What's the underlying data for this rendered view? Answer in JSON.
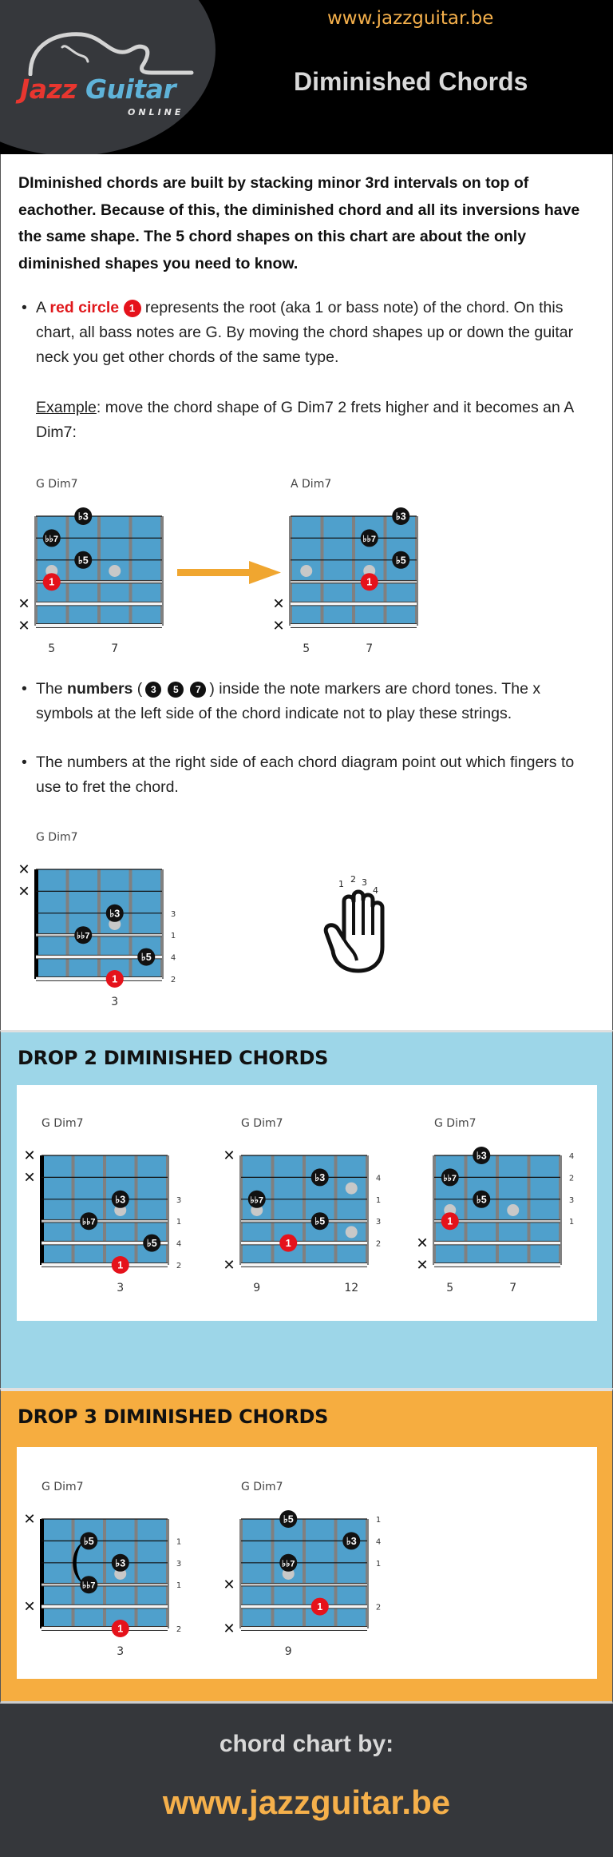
{
  "header": {
    "logo": {
      "word1": "Jazz",
      "word2": "Guitar",
      "sub": "ONLINE"
    },
    "url": "www.jazzguitar.be",
    "title": "Diminished Chords"
  },
  "intro": {
    "lead": "DIminished chords are built by stacking minor 3rd intervals on top of eachother. Because of this, the diminished chord and all its inversions have the same shape. The 5 chord shapes on this chart are about the only diminished shapes you need to know.",
    "bullet1": {
      "prefix": "A ",
      "highlight": "red circle",
      "marker": "1",
      "rest": " represents the root (aka 1 or bass note) of the chord. On this chart, all bass notes are G. By moving the chord shapes up or down the guitar neck you get other chords of the same type."
    },
    "example": {
      "label": "Example",
      "text": ": move the chord shape of G Dim7 2 frets higher and it becomes an A Dim7:"
    },
    "bullet2": {
      "prefix": "The ",
      "bold": "numbers",
      "open": " (",
      "markers": [
        "3",
        "5",
        "7"
      ],
      "rest": ") inside the note markers are chord tones. The x symbols at the left side of the chord indicate not to play these strings."
    },
    "bullet3": "The numbers at the right side of each chord diagram point out which fingers to use to fret the chord.",
    "hand_fingers": [
      "1",
      "2",
      "3",
      "4"
    ]
  },
  "colors": {
    "fretboard": "#4fa0cc",
    "fret": "#808080",
    "root": "#e5121b",
    "note": "#111111",
    "dot": "#c8c8c8",
    "arrow": "#f0a630",
    "drop2_bg": "#9dd6e8",
    "drop3_bg": "#f6ad40",
    "accent": "#f5b04b"
  },
  "chords": {
    "example_g": {
      "title": "G Dim7",
      "muted": [
        5,
        6
      ],
      "fret_labels": [
        {
          "pos": 0.5,
          "text": "5"
        },
        {
          "pos": 2.5,
          "text": "7"
        }
      ],
      "fingers": [],
      "notes": [
        {
          "string": 1,
          "fret": 1.5,
          "label": "b3"
        },
        {
          "string": 2,
          "fret": 0.5,
          "label": "bb7"
        },
        {
          "string": 3,
          "fret": 1.5,
          "label": "b5"
        },
        {
          "string": 4,
          "fret": 0.5,
          "label": "1",
          "root": true
        }
      ],
      "dots": [
        {
          "between": 3.5,
          "fret": 0.5
        },
        {
          "between": 3.5,
          "fret": 2.5
        }
      ],
      "nut": false
    },
    "example_a": {
      "title": "A Dim7",
      "muted": [
        5,
        6
      ],
      "fret_labels": [
        {
          "pos": 0.5,
          "text": "5"
        },
        {
          "pos": 2.5,
          "text": "7"
        }
      ],
      "fingers": [],
      "notes": [
        {
          "string": 1,
          "fret": 3.5,
          "label": "b3"
        },
        {
          "string": 2,
          "fret": 2.5,
          "label": "bb7"
        },
        {
          "string": 3,
          "fret": 3.5,
          "label": "b5"
        },
        {
          "string": 4,
          "fret": 2.5,
          "label": "1",
          "root": true
        }
      ],
      "dots": [
        {
          "between": 3.5,
          "fret": 0.5
        },
        {
          "between": 3.5,
          "fret": 2.5
        }
      ],
      "nut": false
    },
    "finger_example": {
      "title": "G Dim7",
      "muted": [
        1,
        2
      ],
      "fret_labels": [
        {
          "pos": 2.5,
          "text": "3"
        }
      ],
      "fingers": [
        {
          "string": 3,
          "text": "3"
        },
        {
          "string": 4,
          "text": "1"
        },
        {
          "string": 5,
          "text": "4"
        },
        {
          "string": 6,
          "text": "2"
        }
      ],
      "notes": [
        {
          "string": 3,
          "fret": 2.5,
          "label": "b3"
        },
        {
          "string": 4,
          "fret": 1.5,
          "label": "bb7"
        },
        {
          "string": 5,
          "fret": 3.5,
          "label": "b5"
        },
        {
          "string": 6,
          "fret": 2.5,
          "label": "1",
          "root": true
        }
      ],
      "dots": [
        {
          "between": 3.5,
          "fret": 2.5
        }
      ],
      "nut": true
    }
  },
  "drop2": {
    "title": "DROP 2 DIMINISHED CHORDS",
    "chords": [
      {
        "title": "G Dim7",
        "muted": [
          1,
          2
        ],
        "fret_labels": [
          {
            "pos": 2.5,
            "text": "3"
          }
        ],
        "fingers": [
          {
            "string": 3,
            "text": "3"
          },
          {
            "string": 4,
            "text": "1"
          },
          {
            "string": 5,
            "text": "4"
          },
          {
            "string": 6,
            "text": "2"
          }
        ],
        "notes": [
          {
            "string": 3,
            "fret": 2.5,
            "label": "b3"
          },
          {
            "string": 4,
            "fret": 1.5,
            "label": "bb7"
          },
          {
            "string": 5,
            "fret": 3.5,
            "label": "b5"
          },
          {
            "string": 6,
            "fret": 2.5,
            "label": "1",
            "root": true
          }
        ],
        "dots": [
          {
            "between": 3.5,
            "fret": 2.5
          }
        ],
        "nut": true
      },
      {
        "title": "G Dim7",
        "muted": [
          1,
          6
        ],
        "fret_labels": [
          {
            "pos": 0.5,
            "text": "9"
          },
          {
            "pos": 3.5,
            "text": "12"
          }
        ],
        "fingers": [
          {
            "string": 2,
            "text": "4"
          },
          {
            "string": 3,
            "text": "1"
          },
          {
            "string": 4,
            "text": "3"
          },
          {
            "string": 5,
            "text": "2"
          }
        ],
        "notes": [
          {
            "string": 2,
            "fret": 2.5,
            "label": "b3"
          },
          {
            "string": 3,
            "fret": 0.5,
            "label": "bb7"
          },
          {
            "string": 4,
            "fret": 2.5,
            "label": "b5"
          },
          {
            "string": 5,
            "fret": 1.5,
            "label": "1",
            "root": true
          }
        ],
        "dots": [
          {
            "between": 3.5,
            "fret": 0.5
          },
          {
            "between": 2.5,
            "fret": 3.5
          },
          {
            "between": 4.5,
            "fret": 3.5
          }
        ],
        "nut": false
      },
      {
        "title": "G Dim7",
        "muted": [
          5,
          6
        ],
        "fret_labels": [
          {
            "pos": 0.5,
            "text": "5"
          },
          {
            "pos": 2.5,
            "text": "7"
          }
        ],
        "fingers": [
          {
            "string": 1,
            "text": "4"
          },
          {
            "string": 2,
            "text": "2"
          },
          {
            "string": 3,
            "text": "3"
          },
          {
            "string": 4,
            "text": "1"
          }
        ],
        "notes": [
          {
            "string": 1,
            "fret": 1.5,
            "label": "b3"
          },
          {
            "string": 2,
            "fret": 0.5,
            "label": "bb7"
          },
          {
            "string": 3,
            "fret": 1.5,
            "label": "b5"
          },
          {
            "string": 4,
            "fret": 0.5,
            "label": "1",
            "root": true
          }
        ],
        "dots": [
          {
            "between": 3.5,
            "fret": 0.5
          },
          {
            "between": 3.5,
            "fret": 2.5
          }
        ],
        "nut": false
      }
    ]
  },
  "drop3": {
    "title": "DROP 3 DIMINISHED CHORDS",
    "chords": [
      {
        "title": "G Dim7",
        "muted": [
          1,
          5
        ],
        "fret_labels": [
          {
            "pos": 2.5,
            "text": "3"
          }
        ],
        "fingers": [
          {
            "string": 2,
            "text": "1"
          },
          {
            "string": 3,
            "text": "3"
          },
          {
            "string": 4,
            "text": "1"
          },
          {
            "string": 6,
            "text": "2"
          }
        ],
        "notes": [
          {
            "string": 2,
            "fret": 1.5,
            "label": "b5"
          },
          {
            "string": 3,
            "fret": 2.5,
            "label": "b3"
          },
          {
            "string": 4,
            "fret": 1.5,
            "label": "bb7"
          },
          {
            "string": 6,
            "fret": 2.5,
            "label": "1",
            "root": true
          }
        ],
        "dots": [
          {
            "between": 3.5,
            "fret": 2.5
          }
        ],
        "barre": {
          "from": 2,
          "to": 4,
          "fret": 1.5
        },
        "nut": true
      },
      {
        "title": "G Dim7",
        "muted": [
          4,
          6
        ],
        "fret_labels": [
          {
            "pos": 1.5,
            "text": "9"
          }
        ],
        "fingers": [
          {
            "string": 1,
            "text": "1"
          },
          {
            "string": 2,
            "text": "4"
          },
          {
            "string": 3,
            "text": "1"
          },
          {
            "string": 5,
            "text": "2"
          }
        ],
        "notes": [
          {
            "string": 1,
            "fret": 1.5,
            "label": "b5"
          },
          {
            "string": 2,
            "fret": 3.5,
            "label": "b3"
          },
          {
            "string": 3,
            "fret": 1.5,
            "label": "bb7"
          },
          {
            "string": 5,
            "fret": 2.5,
            "label": "1",
            "root": true
          }
        ],
        "dots": [
          {
            "between": 3.5,
            "fret": 1.5
          }
        ],
        "nut": false
      }
    ]
  },
  "footer": {
    "by": "chord chart by:",
    "url": "www.jazzguitar.be"
  }
}
